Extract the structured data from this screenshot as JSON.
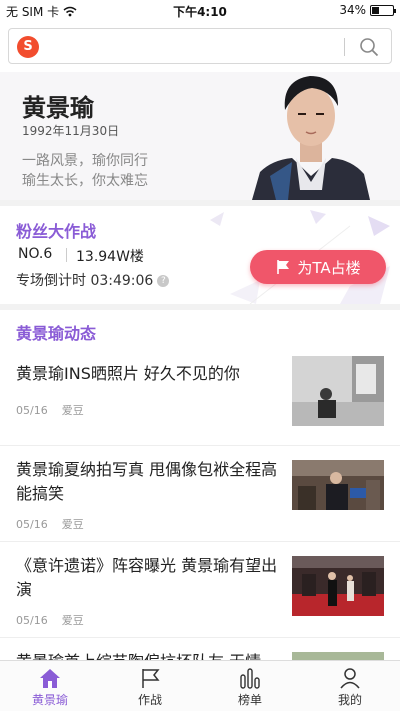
{
  "status_bar": {
    "carrier": "无 SIM 卡",
    "time": "下午4:10",
    "battery": "34%",
    "battery_level": 0.34
  },
  "search": {
    "placeholder": "",
    "value": "",
    "logo_letter": "S"
  },
  "profile": {
    "name": "黄景瑜",
    "birthday": "1992年11月30日",
    "slogan_line1": "一路风景，瑜你同行",
    "slogan_line2": "瑜生太长，你太难忘"
  },
  "fan_battle": {
    "title": "粉丝大作战",
    "rank": "NO.6",
    "floors": "13.94W楼",
    "countdown_label": "专场倒计时",
    "countdown": "03:49:06",
    "help": "?",
    "occupy_button": "为TA占楼"
  },
  "news": {
    "title": "黄景瑜动态",
    "items": [
      {
        "headline": "黄景瑜INS晒照片 好久不见的你",
        "date": "05/16",
        "tag": "爱豆"
      },
      {
        "headline": "黄景瑜夏纳拍写真 甩偶像包袱全程高能搞笑",
        "date": "05/16",
        "tag": "爱豆"
      },
      {
        "headline": "《意许遗诺》阵容曝光 黄景瑜有望出演",
        "date": "05/16",
        "tag": "爱豆"
      },
      {
        "headline": "黄景瑜首上综艺陶偏坑坏队友 无情",
        "date": "",
        "tag": ""
      }
    ]
  },
  "tabs": [
    {
      "label": "黄景瑜",
      "icon": "home-icon"
    },
    {
      "label": "作战",
      "icon": "flag-icon"
    },
    {
      "label": "榜单",
      "icon": "bars-icon"
    },
    {
      "label": "我的",
      "icon": "user-icon"
    }
  ],
  "colors": {
    "accent": "#8a5cd6",
    "button": "#f0566a",
    "logo": "#f24d2e"
  }
}
